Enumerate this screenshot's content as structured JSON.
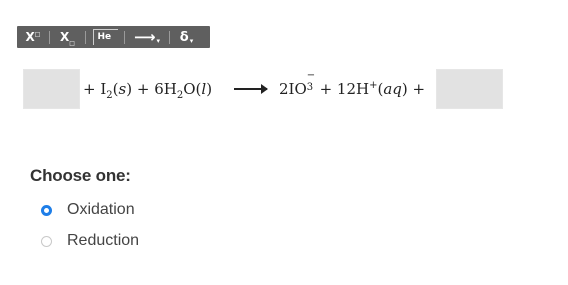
{
  "toolbar": {
    "superscript": {
      "base": "X",
      "mini": "□"
    },
    "subscript": {
      "base": "X",
      "mini": "□"
    },
    "element": {
      "label": "He"
    },
    "arrow": {
      "label": "⟶",
      "caret": "▾"
    },
    "delta": {
      "label": "δ",
      "caret": "▾"
    }
  },
  "equation": {
    "middle": {
      "plus1": "+",
      "i": "I",
      "i_sub": "2",
      "s_open": "(",
      "s": "s",
      "s_close": ")",
      "plus2": "+",
      "coef": "6H",
      "h_sub": "2",
      "o": "O",
      "l_open": "(",
      "l": "l",
      "l_close": ")"
    },
    "right": {
      "coef": "2IO",
      "io_sub": "3",
      "io_sup": "−",
      "plus1": "+",
      "h": "12H",
      "h_sup": "+",
      "aq_open": "(",
      "aq": "aq",
      "aq_close": ")",
      "plus2": "+"
    }
  },
  "question": {
    "prompt": "Choose one:",
    "options": [
      {
        "label": "Oxidation",
        "selected": true
      },
      {
        "label": "Reduction",
        "selected": false
      }
    ]
  }
}
